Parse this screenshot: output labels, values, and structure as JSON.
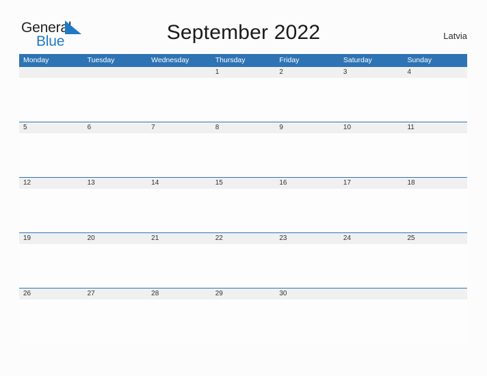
{
  "brand": {
    "word_one": "General",
    "word_two": "Blue",
    "flag_icon": "blue-triangle-flag-icon",
    "accent_color": "#1f7ac4",
    "text_color": "#231f20"
  },
  "header": {
    "title": "September 2022",
    "country": "Latvia"
  },
  "calendar": {
    "header_bg": "#2e73b3",
    "header_text": "#ffffff",
    "date_band_bg": "#f0f0f0",
    "cell_bg": "#fdfdfd",
    "weekday_headers": [
      "Monday",
      "Tuesday",
      "Wednesday",
      "Thursday",
      "Friday",
      "Saturday",
      "Sunday"
    ],
    "weeks": [
      {
        "days": [
          "",
          "",
          "",
          "1",
          "2",
          "3",
          "4"
        ]
      },
      {
        "days": [
          "5",
          "6",
          "7",
          "8",
          "9",
          "10",
          "11"
        ]
      },
      {
        "days": [
          "12",
          "13",
          "14",
          "15",
          "16",
          "17",
          "18"
        ]
      },
      {
        "days": [
          "19",
          "20",
          "21",
          "22",
          "23",
          "24",
          "25"
        ]
      },
      {
        "days": [
          "26",
          "27",
          "28",
          "29",
          "30",
          "",
          ""
        ]
      }
    ]
  }
}
